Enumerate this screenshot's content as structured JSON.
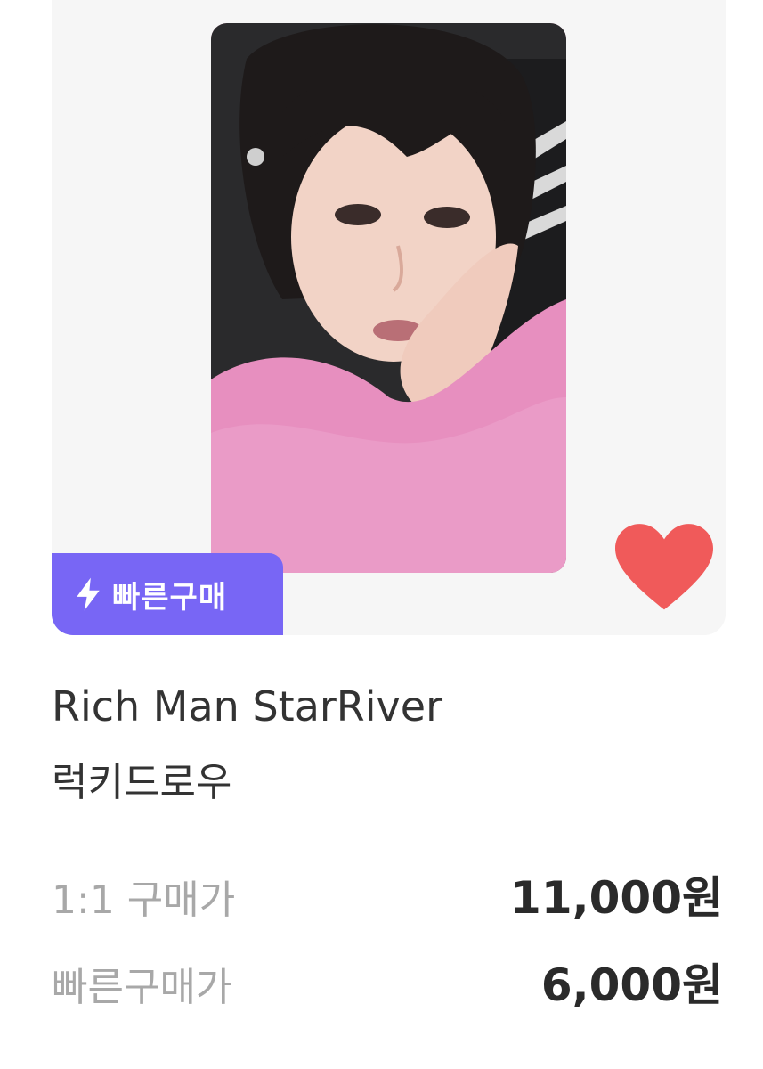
{
  "product": {
    "badge": {
      "icon": "lightning-icon",
      "label": "빠른구매",
      "color": "#7866f5"
    },
    "favorite": {
      "icon": "heart-icon",
      "active": true,
      "color": "#f05a5a"
    },
    "title": "Rich Man StarRiver",
    "subtitle": "럭키드로우",
    "prices": [
      {
        "label": "1:1 구매가",
        "value": "11,000원"
      },
      {
        "label": "빠른구매가",
        "value": "6,000원"
      }
    ]
  }
}
